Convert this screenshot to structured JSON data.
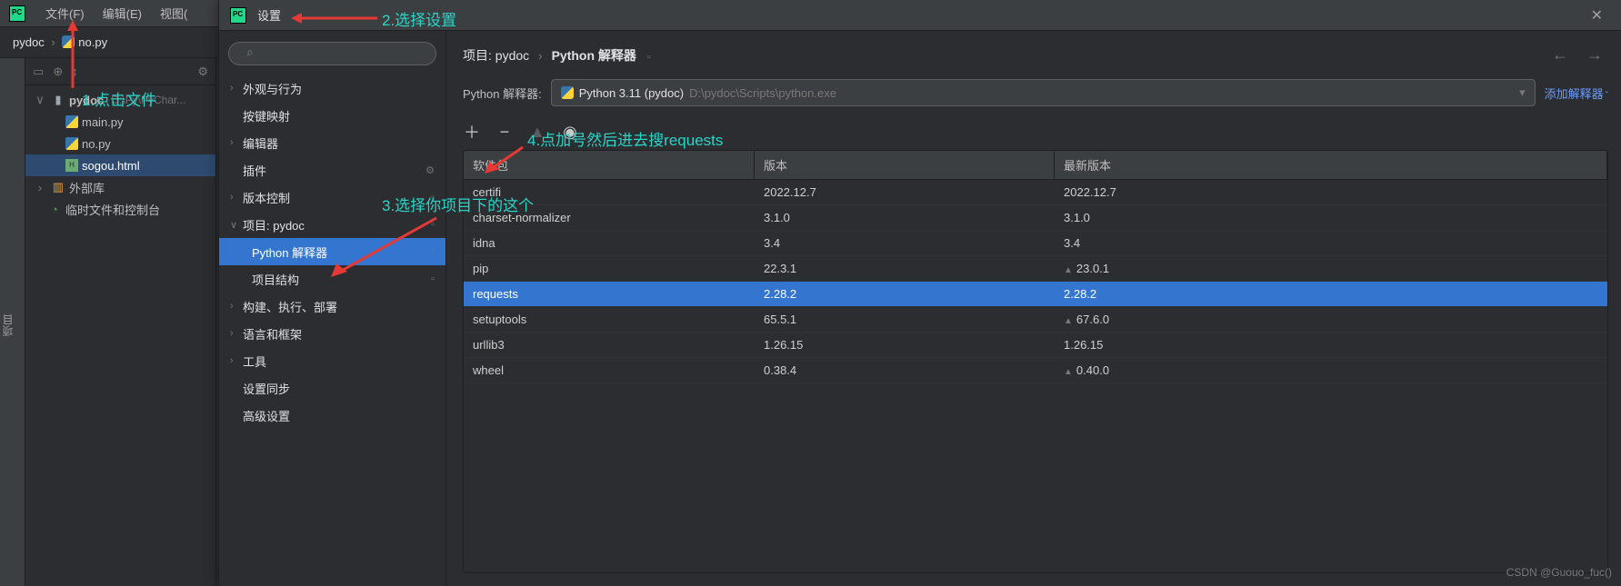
{
  "ide": {
    "menu": {
      "file": "文件(F)",
      "edit": "编辑(E)",
      "view": "视图("
    },
    "breadcrumb": {
      "project": "pydoc",
      "file": "no.py"
    },
    "leftrail": "项目",
    "project_header_title": "",
    "tree": {
      "root": {
        "name": "pydoc",
        "path": "D:\\Py\\PyChar..."
      },
      "files": [
        {
          "name": "main.py",
          "type": "py"
        },
        {
          "name": "no.py",
          "type": "py"
        },
        {
          "name": "sogou.html",
          "type": "html"
        }
      ],
      "ext_libs": "外部库",
      "scratch": "临时文件和控制台"
    }
  },
  "settings": {
    "title": "设置",
    "search_placeholder": "",
    "nav": {
      "appearance": "外观与行为",
      "keymap": "按键映射",
      "editor": "编辑器",
      "plugins": "插件",
      "vcs": "版本控制",
      "project": "项目: pydoc",
      "interpreter": "Python 解释器",
      "structure": "项目结构",
      "build": "构建、执行、部署",
      "lang": "语言和框架",
      "tools": "工具",
      "sync": "设置同步",
      "advanced": "高级设置"
    },
    "content": {
      "breadcrumb": {
        "p1": "项目: pydoc",
        "p2": "Python 解释器"
      },
      "interpreter_label": "Python 解释器:",
      "interpreter_name": "Python 3.11 (pydoc)",
      "interpreter_path": "D:\\pydoc\\Scripts\\python.exe",
      "add_interpreter": "添加解释器",
      "table_headers": {
        "name": "软件包",
        "version": "版本",
        "latest": "最新版本"
      },
      "packages": [
        {
          "name": "certifi",
          "version": "2022.12.7",
          "latest": "2022.12.7",
          "upgradable": false
        },
        {
          "name": "charset-normalizer",
          "version": "3.1.0",
          "latest": "3.1.0",
          "upgradable": false
        },
        {
          "name": "idna",
          "version": "3.4",
          "latest": "3.4",
          "upgradable": false
        },
        {
          "name": "pip",
          "version": "22.3.1",
          "latest": "23.0.1",
          "upgradable": true
        },
        {
          "name": "requests",
          "version": "2.28.2",
          "latest": "2.28.2",
          "upgradable": false,
          "selected": true
        },
        {
          "name": "setuptools",
          "version": "65.5.1",
          "latest": "67.6.0",
          "upgradable": true
        },
        {
          "name": "urllib3",
          "version": "1.26.15",
          "latest": "1.26.15",
          "upgradable": false
        },
        {
          "name": "wheel",
          "version": "0.38.4",
          "latest": "0.40.0",
          "upgradable": true
        }
      ]
    }
  },
  "annotations": {
    "a1": "1.点击文件",
    "a2": "2.选择设置",
    "a3": "3.选择你项目下的这个",
    "a4": "4.点加号然后进去搜requests"
  },
  "watermark": "CSDN @Guouo_fuc()"
}
